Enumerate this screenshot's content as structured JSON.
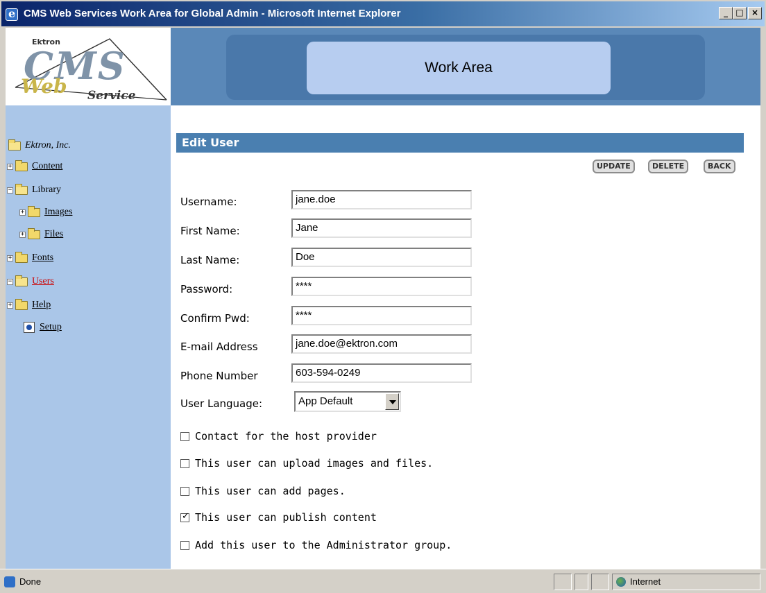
{
  "window": {
    "title": "CMS Web Services Work Area for Global Admin - Microsoft Internet Explorer",
    "minimize": "_",
    "maximize": "□",
    "close": "×"
  },
  "logo": {
    "top_text": "Ektron",
    "big_text": "CMS",
    "web_text": "Web",
    "service_text": "Service"
  },
  "header": {
    "title": "Work Area"
  },
  "tree": {
    "root": "Ektron, Inc.",
    "items": [
      {
        "label": "Content"
      },
      {
        "label": "Library"
      },
      {
        "label": "Images"
      },
      {
        "label": "Files"
      },
      {
        "label": "Fonts"
      },
      {
        "label": "Users"
      },
      {
        "label": "Help"
      },
      {
        "label": "Setup"
      }
    ]
  },
  "section": {
    "title": "Edit User"
  },
  "actions": {
    "update": "UPDATE",
    "delete": "DELETE",
    "back": "BACK"
  },
  "form": {
    "fields": [
      {
        "label": "Username:",
        "value": "jane.doe"
      },
      {
        "label": "First Name:",
        "value": "Jane"
      },
      {
        "label": "Last Name:",
        "value": "Doe"
      },
      {
        "label": "Password:",
        "value": "****"
      },
      {
        "label": "Confirm Pwd:",
        "value": "****"
      },
      {
        "label": "E-mail Address",
        "value": "jane.doe@ektron.com"
      },
      {
        "label": "Phone Number",
        "value": "603-594-0249"
      }
    ],
    "language": {
      "label": "User Language:",
      "value": "App Default"
    },
    "checkboxes": [
      {
        "label": "Contact for the host provider",
        "checked": false
      },
      {
        "label": "This user can upload images and files.",
        "checked": false
      },
      {
        "label": "This user can add pages.",
        "checked": false
      },
      {
        "label": "This user can publish content",
        "checked": true
      },
      {
        "label": "Add this user to the Administrator group.",
        "checked": false
      }
    ]
  },
  "status": {
    "left": "Done",
    "zone": "Internet"
  },
  "colors": {
    "nav_bg": "#aac6e8",
    "section_bar": "#4a7fb0",
    "header_bg": "#5a88b8",
    "users_link": "#cc0000"
  }
}
